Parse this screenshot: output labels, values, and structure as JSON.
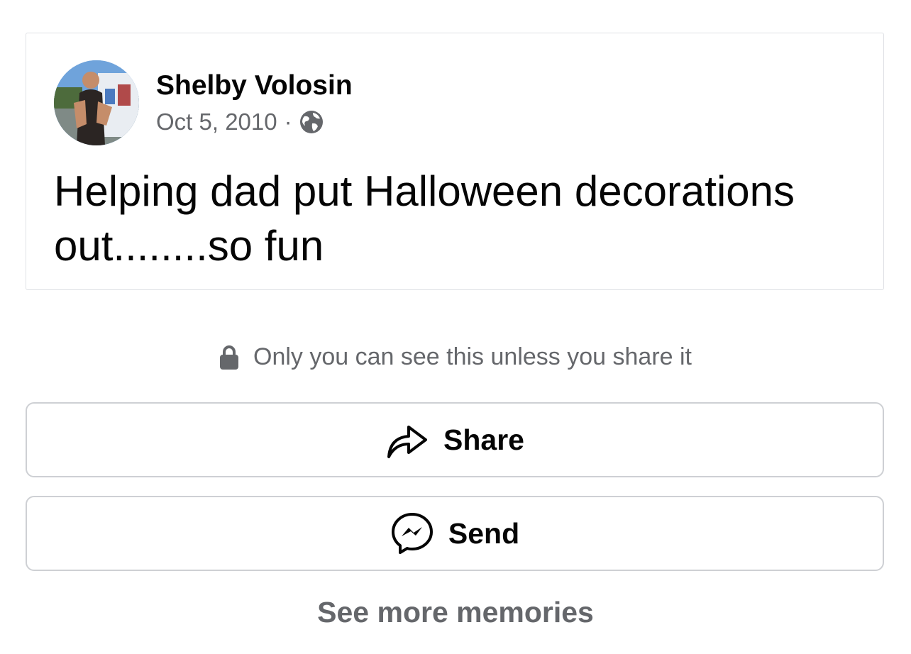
{
  "post": {
    "author": "Shelby Volosin",
    "date": "Oct 5, 2010",
    "separator": "·",
    "audience_icon": "globe-icon",
    "text": "Helping dad put Halloween decorations out........so fun"
  },
  "privacy": {
    "icon": "lock-icon",
    "text": "Only you can see this unless you share it"
  },
  "actions": {
    "share": {
      "icon": "share-arrow-icon",
      "label": "Share"
    },
    "send": {
      "icon": "messenger-icon",
      "label": "Send"
    }
  },
  "footer": {
    "see_more_label": "See more memories"
  },
  "colors": {
    "primary_text": "#050505",
    "secondary_text": "#65676b",
    "border": "#ced0d4"
  }
}
